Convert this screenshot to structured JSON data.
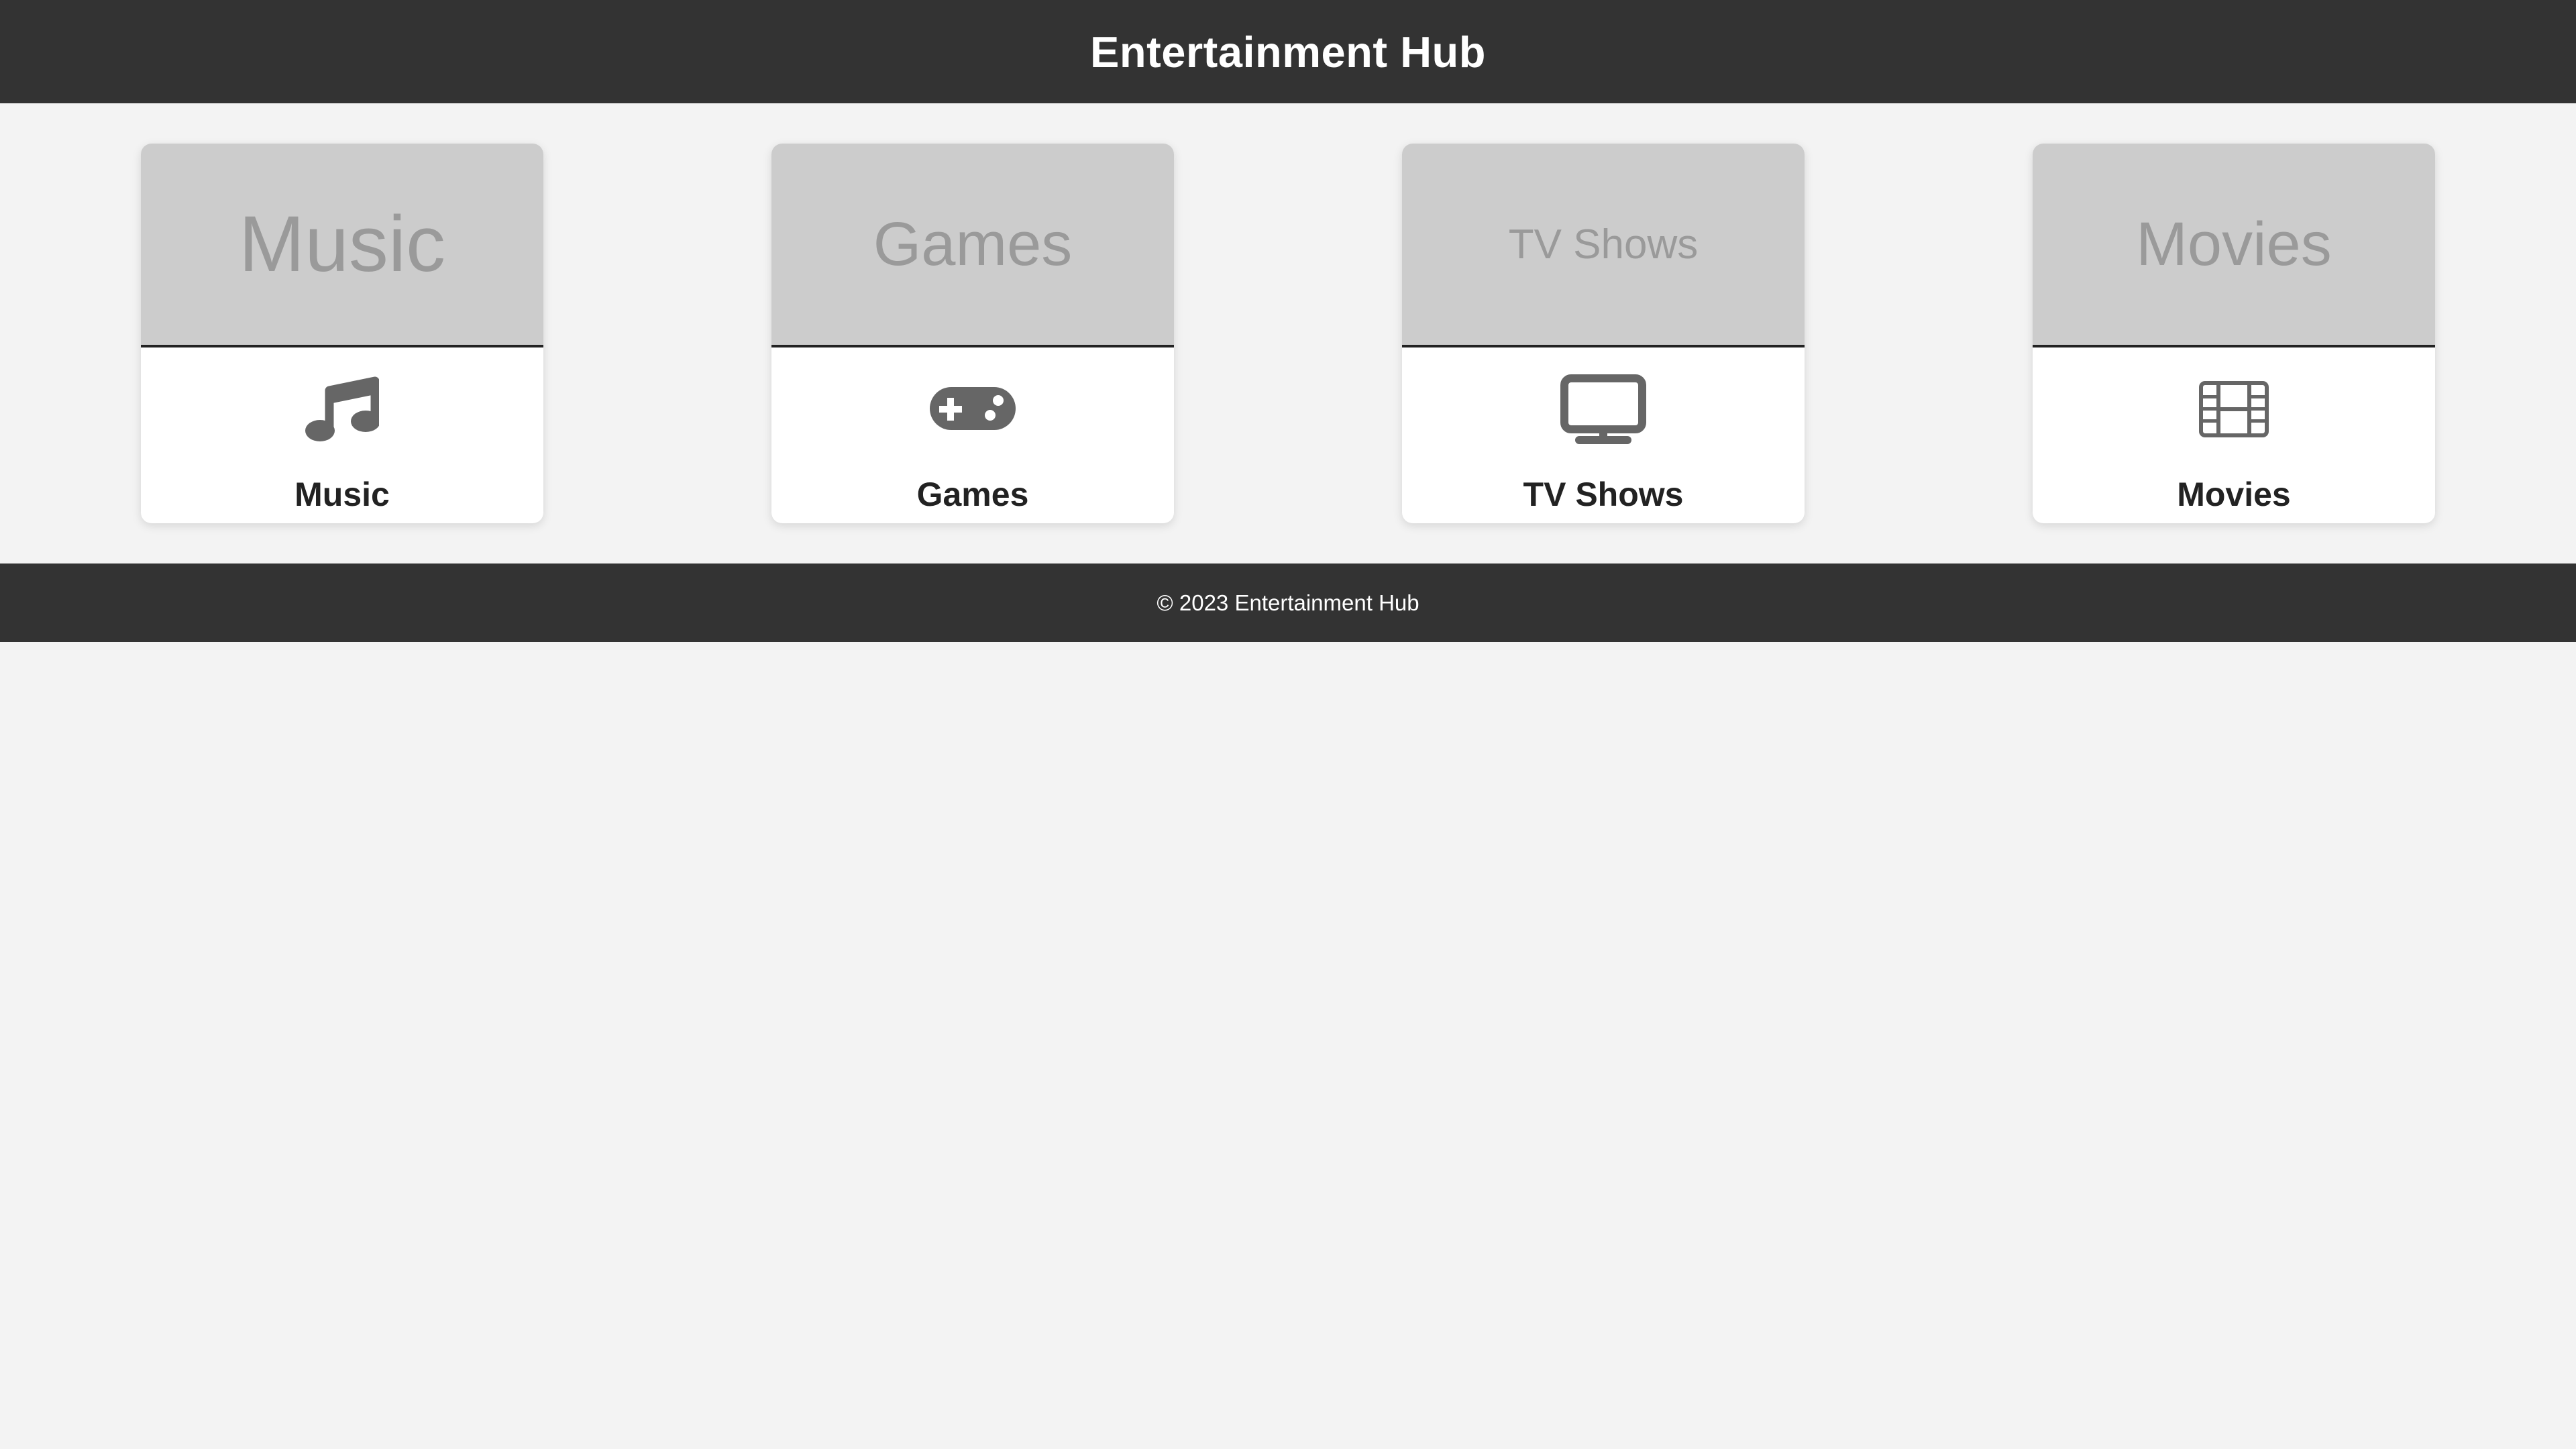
{
  "header": {
    "title": "Entertainment Hub"
  },
  "cards": [
    {
      "image_text": "Music",
      "label": "Music",
      "icon": "music-note-icon"
    },
    {
      "image_text": "Games",
      "label": "Games",
      "icon": "gamepad-icon"
    },
    {
      "image_text": "TV Shows",
      "label": "TV Shows",
      "icon": "tv-icon"
    },
    {
      "image_text": "Movies",
      "label": "Movies",
      "icon": "film-icon"
    }
  ],
  "footer": {
    "text": "© 2023 Entertainment Hub"
  },
  "colors": {
    "header_bg": "#333333",
    "page_bg": "#f3f3f3",
    "card_image_bg": "#cccccc",
    "icon": "#666666",
    "text_dark": "#222222"
  }
}
